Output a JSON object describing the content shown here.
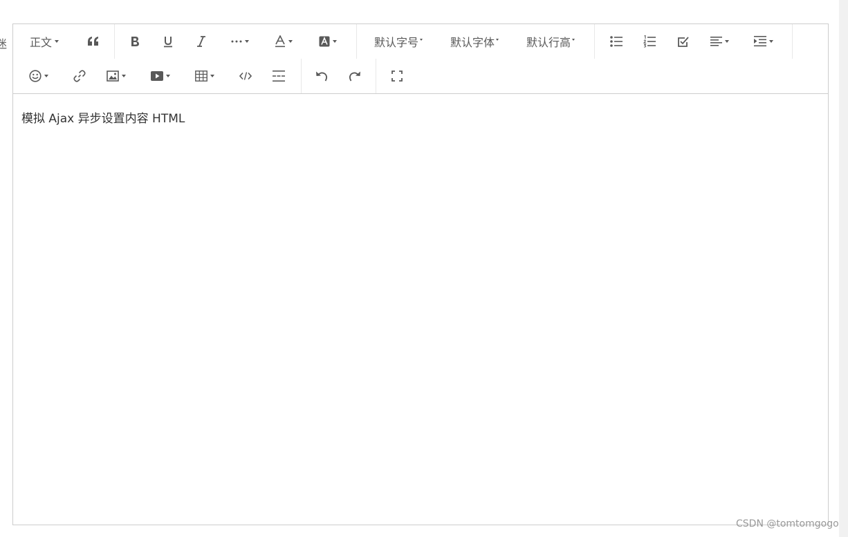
{
  "toolbar": {
    "header_label": "正文",
    "font_size": "默认字号",
    "font_family": "默认字体",
    "line_height": "默认行高"
  },
  "editor": {
    "content_text": "模拟 Ajax 异步设置内容 HTML"
  },
  "watermark": "CSDN @tomtomgogo",
  "clipped_text": "迷"
}
